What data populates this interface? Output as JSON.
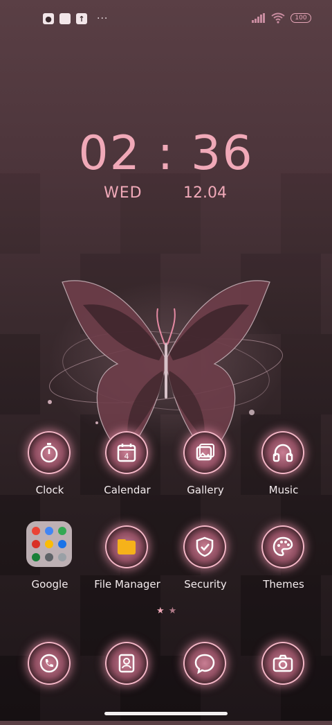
{
  "status_bar": {
    "left_icons": [
      "notification-icon",
      "square-icon",
      "upload-icon"
    ],
    "more": "···",
    "battery": "100",
    "signal": "signal-icon",
    "wifi": "wifi-icon"
  },
  "clock": {
    "time": "02 : 36",
    "day": "WED",
    "date": "12.04"
  },
  "apps_row1": [
    {
      "label": "Clock",
      "icon": "clock-icon"
    },
    {
      "label": "Calendar",
      "icon": "calendar-icon",
      "day": "4"
    },
    {
      "label": "Gallery",
      "icon": "gallery-icon"
    },
    {
      "label": "Music",
      "icon": "headphones-icon"
    }
  ],
  "apps_row2": [
    {
      "label": "Google",
      "icon": "google-folder-icon"
    },
    {
      "label": "File Manager",
      "icon": "folder-icon"
    },
    {
      "label": "Security",
      "icon": "shield-icon"
    },
    {
      "label": "Themes",
      "icon": "palette-icon"
    }
  ],
  "dock": [
    {
      "icon": "phone-icon"
    },
    {
      "icon": "contacts-icon"
    },
    {
      "icon": "messages-icon"
    },
    {
      "icon": "camera-icon"
    }
  ],
  "page_indicator": {
    "current": 1,
    "total": 2
  },
  "colors": {
    "accent": "#f0a9b8",
    "ring": "#f4b6c6",
    "label": "#f4ecee"
  }
}
